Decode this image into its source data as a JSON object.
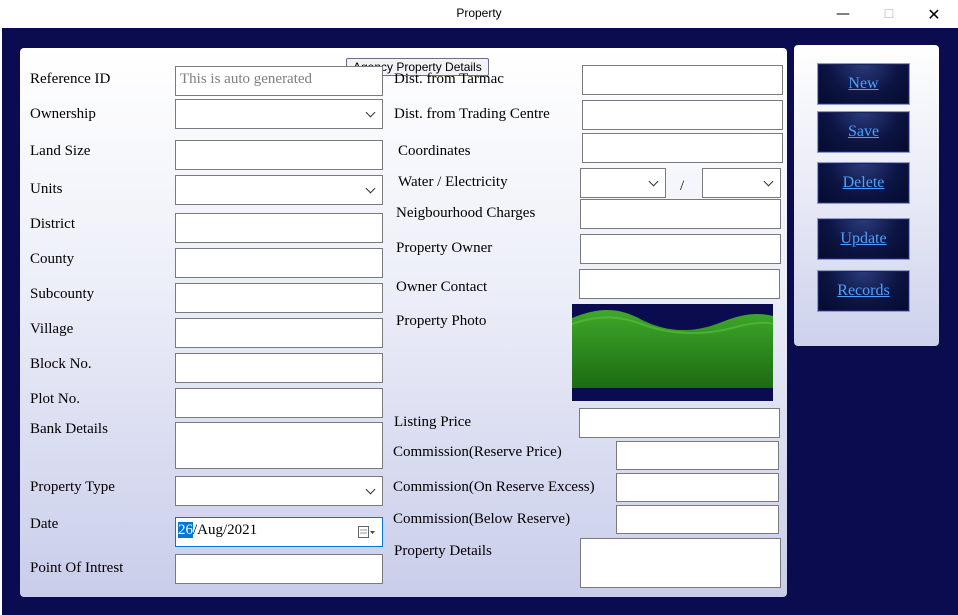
{
  "window": {
    "title": "Property"
  },
  "group_caption": "Agency Property Details",
  "left": {
    "reference_id": {
      "label": "Reference ID",
      "placeholder": "This is auto generated"
    },
    "ownership": {
      "label": "Ownership"
    },
    "land_size": {
      "label": "Land Size"
    },
    "units": {
      "label": "Units"
    },
    "district": {
      "label": "District"
    },
    "county": {
      "label": "County"
    },
    "subcounty": {
      "label": "Subcounty"
    },
    "village": {
      "label": "Village"
    },
    "block_no": {
      "label": "Block No."
    },
    "plot_no": {
      "label": "Plot No."
    },
    "bank_details": {
      "label": "Bank Details"
    },
    "property_type": {
      "label": "Property Type"
    },
    "date": {
      "label": "Date",
      "day": "26",
      "rest": "/Aug/2021"
    },
    "point_of_interest": {
      "label": "Point Of Intrest"
    }
  },
  "right": {
    "dist_tarmac": {
      "label": "Dist. from Tarmac"
    },
    "dist_trading": {
      "label": "Dist. from Trading Centre"
    },
    "coordinates": {
      "label": "Coordinates"
    },
    "water_electricity": {
      "label": "Water / Electricity",
      "separator": "/"
    },
    "neighbourhood_charges": {
      "label": "Neigbourhood Charges"
    },
    "property_owner": {
      "label": "Property Owner"
    },
    "owner_contact": {
      "label": "Owner Contact"
    },
    "property_photo": {
      "label": "Property Photo"
    },
    "listing_price": {
      "label": "Listing Price"
    },
    "commission_reserve": {
      "label": "Commission(Reserve Price)"
    },
    "commission_excess": {
      "label": "Commission(On Reserve Excess)"
    },
    "commission_below": {
      "label": "Commission(Below Reserve)"
    },
    "property_details": {
      "label": "Property Details"
    }
  },
  "actions": {
    "new": "New",
    "save": "Save",
    "delete": "Delete",
    "update": "Update",
    "records": "Records"
  },
  "colors": {
    "background": "#0b0b4f",
    "button_text": "#4da0ff",
    "date_highlight": "#0078d7"
  },
  "icons": {
    "minimize": "minimize-icon",
    "maximize": "maximize-icon",
    "close": "close-icon",
    "calendar": "calendar-icon",
    "dropdown": "chevron-down-icon"
  }
}
